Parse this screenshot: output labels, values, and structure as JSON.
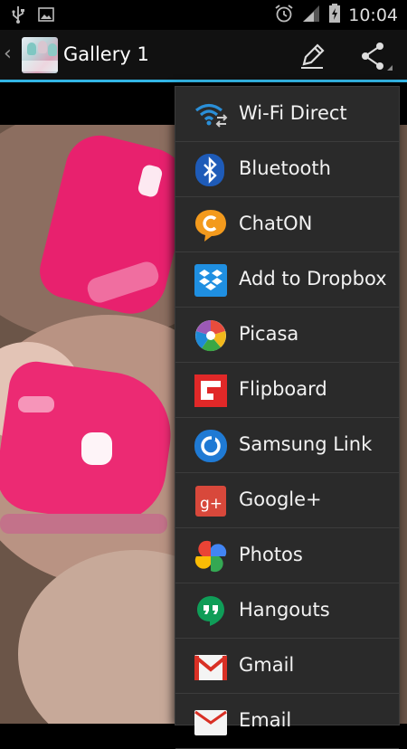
{
  "status_bar": {
    "time": "10:04"
  },
  "action_bar": {
    "title": "Gallery 1"
  },
  "share_menu": {
    "items": [
      {
        "label": "Wi-Fi Direct",
        "icon": "wifi-direct-icon"
      },
      {
        "label": "Bluetooth",
        "icon": "bluetooth-icon"
      },
      {
        "label": "ChatON",
        "icon": "chaton-icon"
      },
      {
        "label": "Add to Dropbox",
        "icon": "dropbox-icon"
      },
      {
        "label": "Picasa",
        "icon": "picasa-icon"
      },
      {
        "label": "Flipboard",
        "icon": "flipboard-icon"
      },
      {
        "label": "Samsung Link",
        "icon": "samsung-link-icon"
      },
      {
        "label": "Google+",
        "icon": "google-plus-icon"
      },
      {
        "label": "Photos",
        "icon": "photos-icon"
      },
      {
        "label": "Hangouts",
        "icon": "hangouts-icon"
      },
      {
        "label": "Gmail",
        "icon": "gmail-icon"
      },
      {
        "label": "Email",
        "icon": "email-icon"
      }
    ]
  },
  "colors": {
    "accent": "#33b5e5",
    "polish": "#e8216e"
  }
}
